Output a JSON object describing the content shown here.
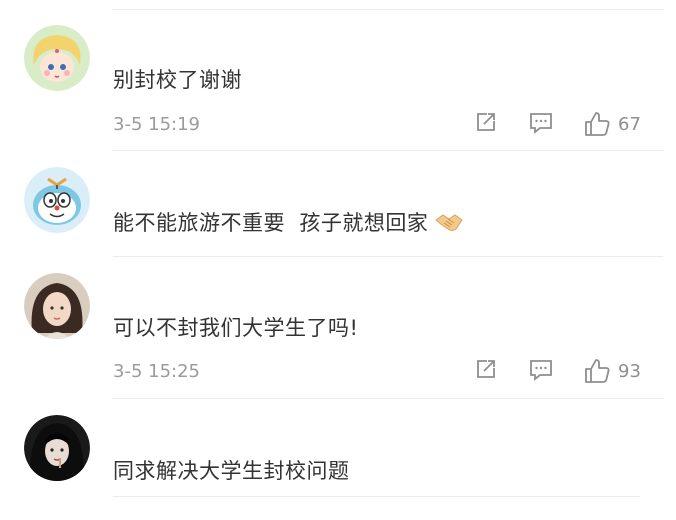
{
  "comments": [
    {
      "text": "别封校了谢谢",
      "time": "3-5 15:19",
      "likes": "67",
      "avatar": "cartoon-sailor-girl-avatar"
    },
    {
      "text": "能不能旅游不重要  孩子就想回家",
      "time": "",
      "likes": "",
      "avatar": "cartoon-doraemon-avatar",
      "emoji": "handshake-emoji"
    },
    {
      "text": "可以不封我们大学生了吗!",
      "time": "3-5 15:25",
      "likes": "93",
      "avatar": "photo-girl-avatar"
    },
    {
      "text": "同求解决大学生封校问题",
      "time": "",
      "likes": "",
      "avatar": "photo-dark-hair-girl-avatar"
    }
  ],
  "icons": {
    "share": "share-icon",
    "reply": "comment-icon",
    "like": "thumbs-up-icon"
  },
  "colors": {
    "text": "#333333",
    "meta": "#9b9b9b",
    "divider": "#ececec"
  }
}
